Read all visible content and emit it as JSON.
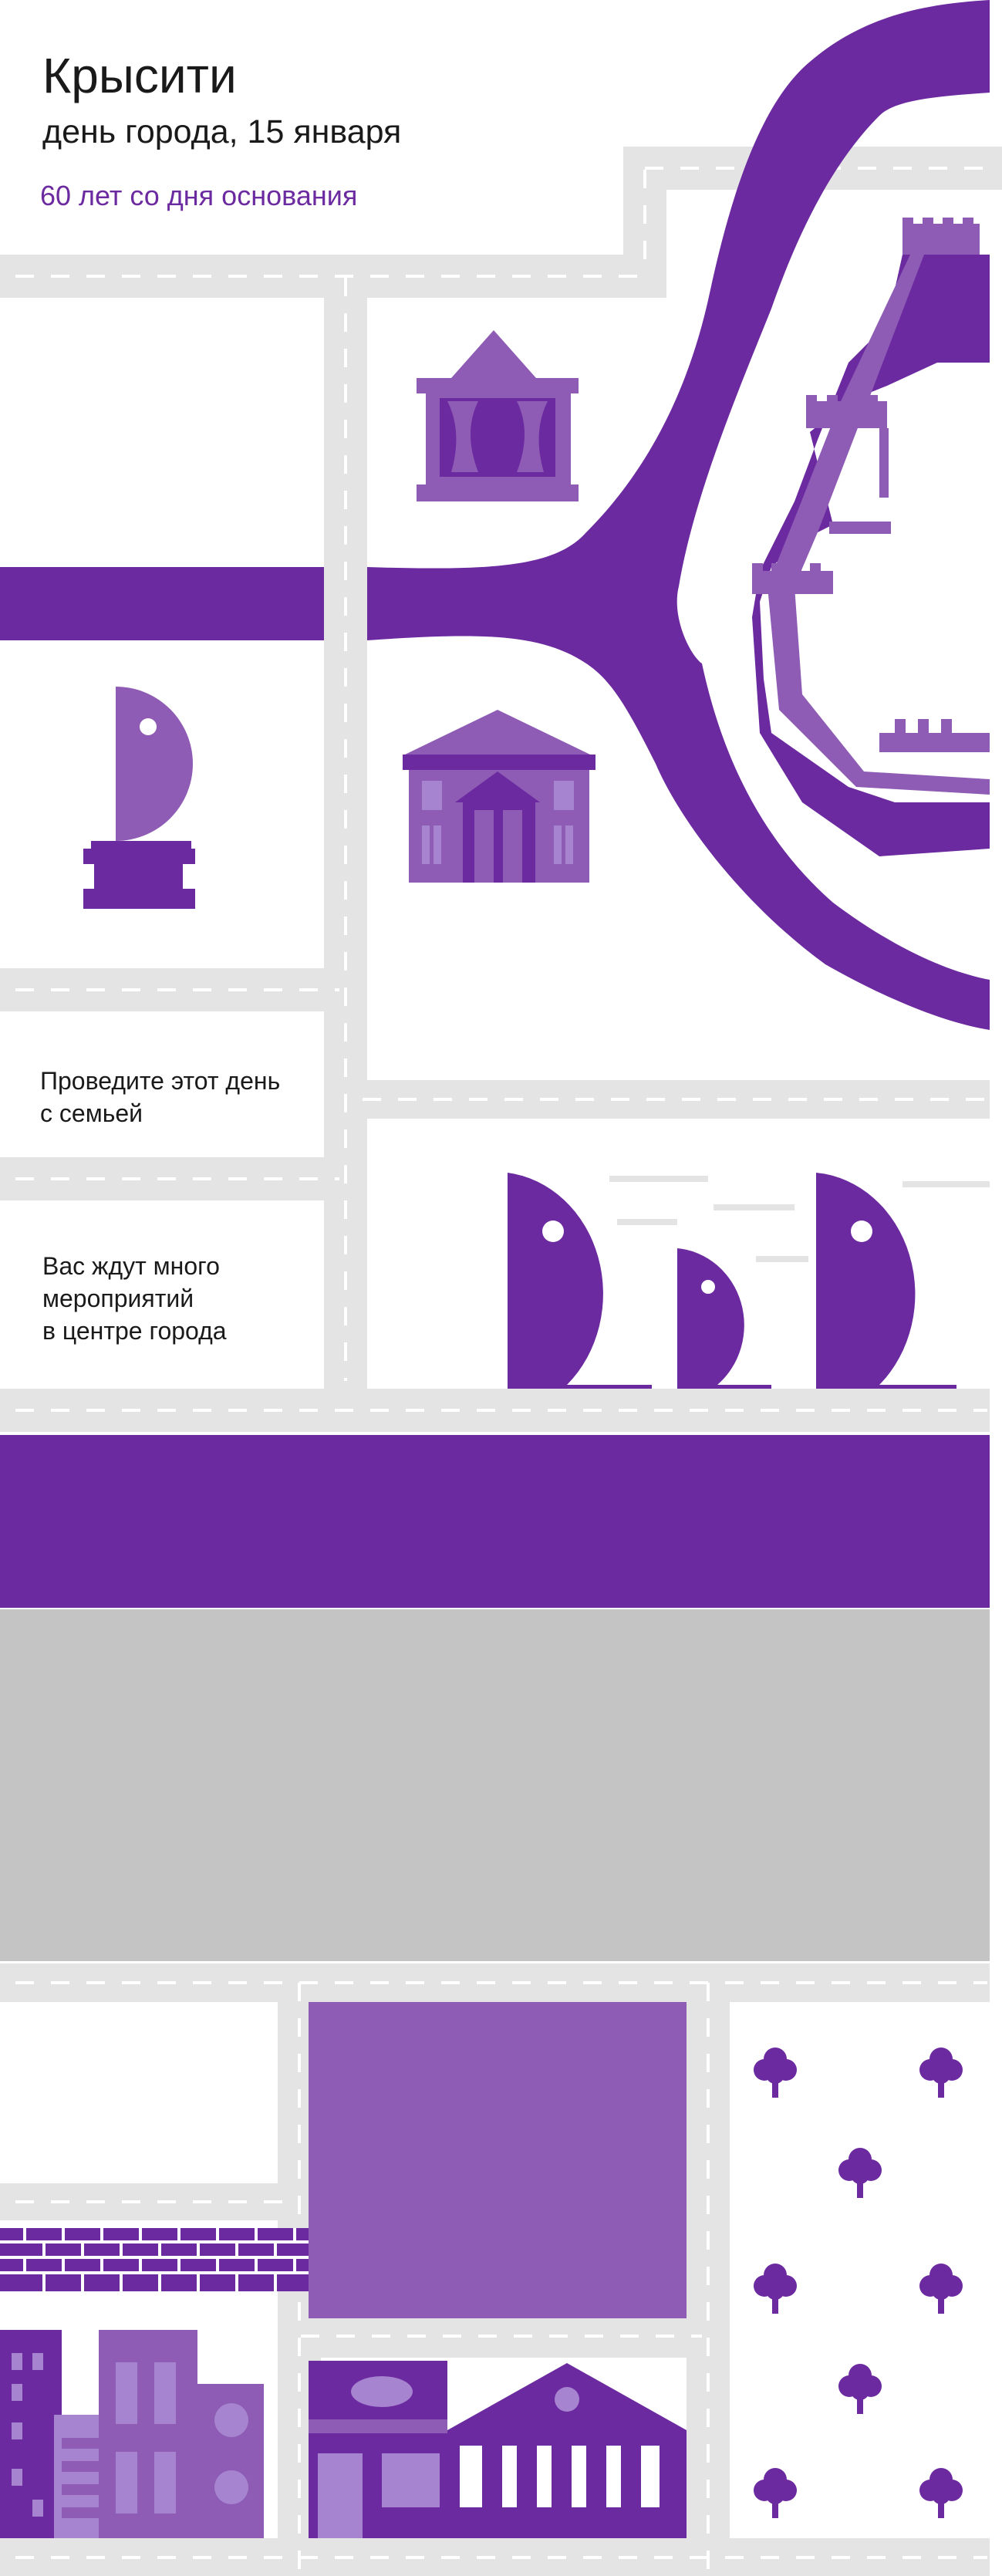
{
  "header": {
    "title": "Крысити",
    "subtitle": "день города, 15 января",
    "anniversary": "60 лет со дня основания"
  },
  "taglines": {
    "family": "Проведите этот день\nс семьей",
    "events": "Вас ждут много\nмероприятий\nв центре города"
  },
  "colors": {
    "accent": "#6c2aa0",
    "accent_light": "#8e5cb5",
    "accent_pale": "#a784cf",
    "road": "#e4e4e4",
    "road_mark": "#ffffff",
    "placeholder": "#c4c4c4"
  },
  "icons": [
    "river-icon",
    "theatre-icon",
    "museum-icon",
    "fortress-wall-icon",
    "knight-statue-icon",
    "rat-heads-icon",
    "brick-wall-icon",
    "apartment-blocks-icon",
    "shopping-center-icon",
    "columned-building-icon",
    "tree-icon"
  ]
}
